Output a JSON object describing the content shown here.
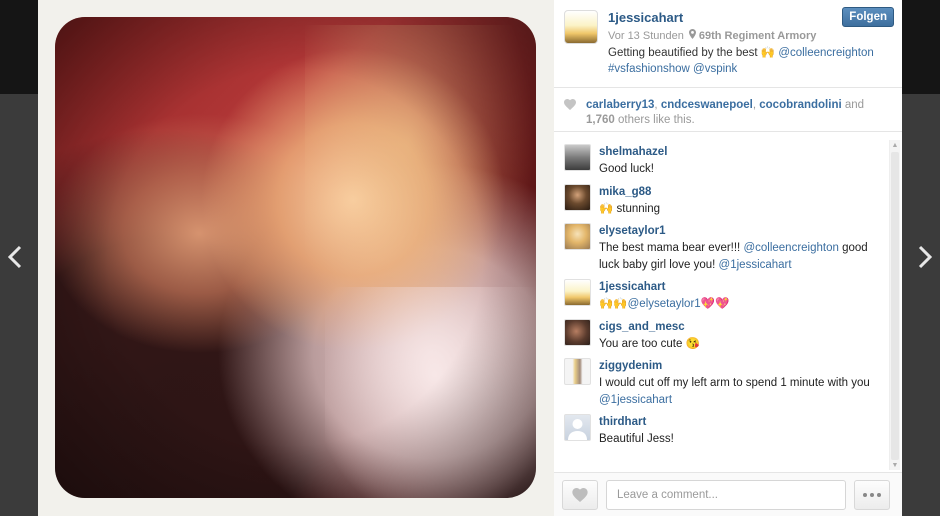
{
  "navigation": {
    "prev_icon": "chevron-left-icon",
    "next_icon": "chevron-right-icon"
  },
  "post": {
    "username": "1jessicahart",
    "time": "Vor 13 Stunden",
    "location": "69th Regiment Armory",
    "follow_label": "Folgen",
    "caption": {
      "text_before": "Getting beautified by the best 🙌 ",
      "mention": "@colleencreighton",
      "hashtag": "#vsfashionshow",
      "mention2": "@vspink"
    }
  },
  "likes": {
    "names": [
      "carlaberry13",
      "cndceswanepoel",
      "cocobrandolini"
    ],
    "and_word": "and",
    "count": "1,760",
    "suffix": "others like this."
  },
  "comments": [
    {
      "user": "shelmahazel",
      "text": "Good luck!"
    },
    {
      "user": "mika_g88",
      "text": "🙌 stunning"
    },
    {
      "user": "elysetaylor1",
      "text_before": "The best mama bear ever!!! ",
      "mention": "@colleencreighton",
      "text_middle": " good luck baby girl love you! ",
      "mention2": "@1jessicahart"
    },
    {
      "user": "1jessicahart",
      "mention": "🙌🙌@elysetaylor1",
      "text_after": "💖💖"
    },
    {
      "user": "cigs_and_mesc",
      "text": "You are too cute 😘"
    },
    {
      "user": "ziggydenim",
      "text_before": "I would cut off my left arm to spend 1 minute with you ",
      "mention": "@1jessicahart"
    },
    {
      "user": "thirdhart",
      "text": "Beautiful Jess!"
    }
  ],
  "footer": {
    "comment_placeholder": "Leave a comment..."
  },
  "colors": {
    "link": "#3b6ea0",
    "username": "#2c5a86",
    "follow": "#4a7aa8"
  }
}
